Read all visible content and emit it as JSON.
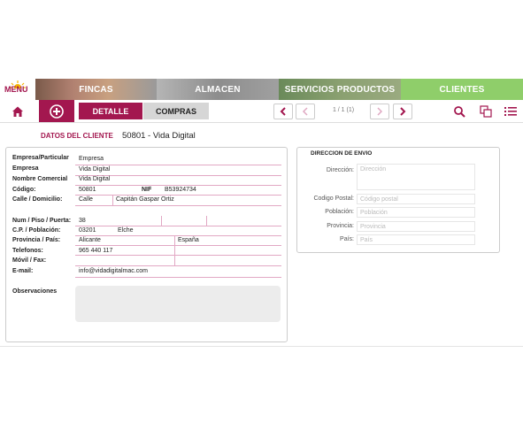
{
  "nav": {
    "menu_label": "MENU",
    "tabs": [
      {
        "label": "FINCAS"
      },
      {
        "label": "ALMACEN"
      },
      {
        "label": "SERVICIOS PRODUCTOS"
      },
      {
        "label": "CLIENTES"
      }
    ]
  },
  "toolbar": {
    "detalle_label": "DETALLE",
    "compras_label": "COMPRAS",
    "pagination": "1 / 1 (1)"
  },
  "header": {
    "section_label": "DATOS DEL CLIENTE",
    "record_title": "50801 - Vida Digital"
  },
  "form": {
    "labels": {
      "empresa_particular": "Empresa/Particular",
      "empresa": "Empresa",
      "nombre_comercial": "Nombre Comercial",
      "codigo": "Código:",
      "nif": "NIF",
      "calle": "Calle / Domicilio:",
      "num_piso": "Num / Piso / Puerta:",
      "cp_poblacion": "C.P. / Población:",
      "provincia_pais": "Provincia / País:",
      "telefonos": "Telefonos:",
      "movil_fax": "Móvil / Fax:",
      "email": "E-mail:",
      "observaciones": "Observaciones"
    },
    "values": {
      "empresa_particular": "Empresa",
      "empresa": "Vida Digital",
      "nombre_comercial": "Vida Digital",
      "codigo": "50801",
      "nif": "B53924734",
      "calle_tipo": "Calle",
      "calle_nombre": "Capitán Gaspar Ortiz",
      "num": "38",
      "cp": "03201",
      "poblacion": "Elche",
      "provincia": "Alicante",
      "pais": "España",
      "telefono": "965 440 117",
      "email": "info@vidadigitalmac.com"
    }
  },
  "envio": {
    "title": "DIRECCION DE ENVIO",
    "fields": [
      {
        "label": "Dirección:",
        "placeholder": "Dirección"
      },
      {
        "label": "Codigo Postal:",
        "placeholder": "Código postal"
      },
      {
        "label": "Población:",
        "placeholder": "Población"
      },
      {
        "label": "Provincia:",
        "placeholder": "Provincia"
      },
      {
        "label": "País:",
        "placeholder": "País"
      }
    ]
  },
  "colors": {
    "accent": "#a3174f",
    "clientes_tab": "#8fce6a",
    "nav_gray": "#8a8a8a"
  }
}
